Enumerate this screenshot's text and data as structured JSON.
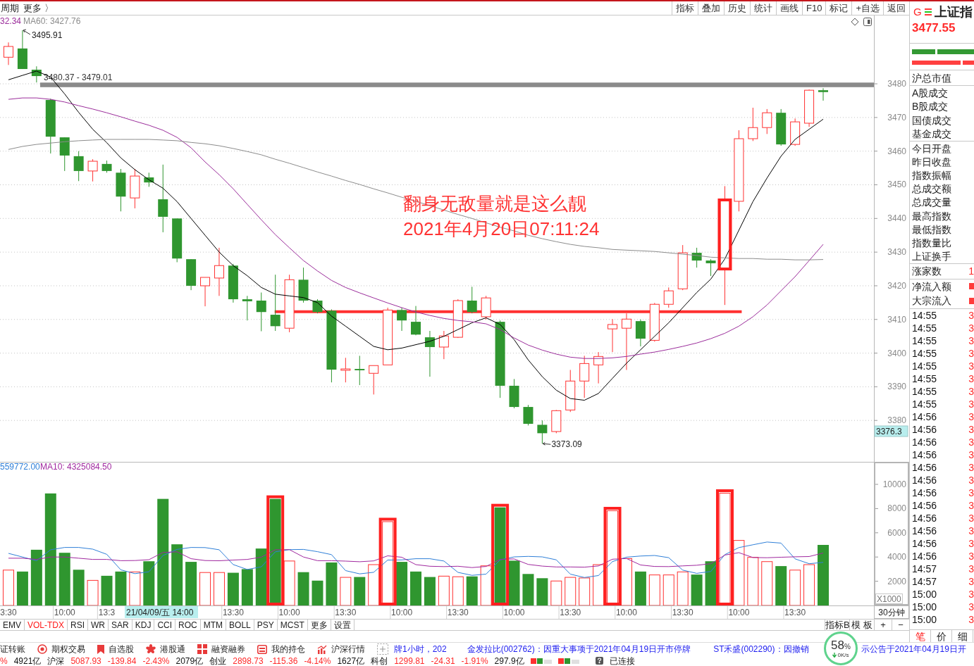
{
  "toolbar": {
    "menus": [
      "周期",
      "更多 〉"
    ],
    "buttons": [
      "指标",
      "叠加",
      "历史",
      "统计",
      "画线",
      "F10",
      "标记",
      "+自选",
      "返回"
    ]
  },
  "chart": {
    "price_legend": [
      {
        "text": "32.34",
        "color": "#9b2d9b"
      },
      {
        "text": "MA60: 3427.76",
        "color": "#8c8c8c"
      }
    ],
    "volume_legend": [
      {
        "text": "559772.00",
        "color": "#2f7fd8"
      },
      {
        "text": "MA10: 4325084.50",
        "color": "#a0289f"
      }
    ],
    "cursor_price": "3376.3",
    "cursor_time": "21/04/09/五 14:00",
    "period": "30分钟",
    "chart_data": [
      {
        "type": "candlestick",
        "ylim": [
          3367.7,
          3500.3
        ],
        "yticks": [
          3380,
          3390,
          3400,
          3410,
          3420,
          3430,
          3440,
          3450,
          3460,
          3470,
          3480
        ],
        "tick_labels": "y",
        "grid": true,
        "ohlc": [
          [
            3487.9,
            3492.3,
            3485.6,
            3491.1
          ],
          [
            3490.5,
            3495.91,
            3484.4,
            3484.4
          ],
          [
            3484.2,
            3485.2,
            3480.4,
            3482.3
          ],
          [
            3475.2,
            3475.6,
            3459.3,
            3464.3
          ],
          [
            3464.1,
            3464.1,
            3454.1,
            3458.7
          ],
          [
            3458.5,
            3460.0,
            3451.1,
            3454.1
          ],
          [
            3454.1,
            3457.6,
            3451.0,
            3457.0
          ],
          [
            3456.2,
            3457.2,
            3453.6,
            3454.1
          ],
          [
            3453.6,
            3454.7,
            3442.1,
            3446.5
          ],
          [
            3446.1,
            3454.7,
            3443.0,
            3452.6
          ],
          [
            3452.2,
            3453.6,
            3449.4,
            3450.7
          ],
          [
            3445.7,
            3456.0,
            3435.9,
            3440.5
          ],
          [
            3440.0,
            3440.0,
            3427.0,
            3428.1
          ],
          [
            3427.9,
            3427.9,
            3418.7,
            3420.0
          ],
          [
            3420.0,
            3422.5,
            3413.9,
            3422.5
          ],
          [
            3422.3,
            3431.3,
            3417.0,
            3426.0
          ],
          [
            3426.0,
            3426.5,
            3415.0,
            3416.0
          ],
          [
            3416.0,
            3417.0,
            3409.7,
            3415.4
          ],
          [
            3415.6,
            3418.0,
            3406.5,
            3412.2
          ],
          [
            3411.4,
            3423.3,
            3406.6,
            3408.0
          ],
          [
            3407.4,
            3423.3,
            3406.2,
            3421.8
          ],
          [
            3421.8,
            3425.4,
            3415.0,
            3415.6
          ],
          [
            3415.6,
            3416.0,
            3411.8,
            3412.2
          ],
          [
            3412.6,
            3413.0,
            3391.3,
            3395.1
          ],
          [
            3394.9,
            3398.6,
            3391.3,
            3395.3
          ],
          [
            3395.3,
            3399.2,
            3390.5,
            3394.9
          ],
          [
            3394.0,
            3396.3,
            3387.7,
            3396.3
          ],
          [
            3396.5,
            3413.5,
            3396.5,
            3412.8
          ],
          [
            3412.8,
            3413.5,
            3406.6,
            3409.7
          ],
          [
            3409.3,
            3414.0,
            3405.3,
            3405.5
          ],
          [
            3404.7,
            3406.6,
            3393.0,
            3401.8
          ],
          [
            3401.8,
            3406.6,
            3398.2,
            3405.1
          ],
          [
            3404.7,
            3416.0,
            3404.5,
            3415.6
          ],
          [
            3415.6,
            3419.7,
            3411.8,
            3412.2
          ],
          [
            3410.8,
            3417.0,
            3410.0,
            3416.4
          ],
          [
            3409.3,
            3409.7,
            3386.7,
            3390.3
          ],
          [
            3390.3,
            3392.3,
            3383.6,
            3384.0
          ],
          [
            3384.0,
            3384.6,
            3378.5,
            3379.0
          ],
          [
            3378.7,
            3380.0,
            3373.09,
            3376.2
          ],
          [
            3376.7,
            3383.1,
            3376.2,
            3382.9
          ],
          [
            3383.1,
            3395.0,
            3382.5,
            3391.7
          ],
          [
            3391.7,
            3399.2,
            3386.7,
            3396.9
          ],
          [
            3396.5,
            3400.3,
            3391.0,
            3399.0
          ],
          [
            3407.2,
            3410.1,
            3400.3,
            3408.5
          ],
          [
            3407.4,
            3411.8,
            3395.0,
            3410.1
          ],
          [
            3409.5,
            3410.0,
            3402.0,
            3404.3
          ],
          [
            3403.8,
            3414.9,
            3403.4,
            3414.5
          ],
          [
            3414.5,
            3419.5,
            3413.5,
            3418.5
          ],
          [
            3419.1,
            3432.1,
            3418.7,
            3429.8
          ],
          [
            3429.8,
            3431.3,
            3425.4,
            3427.5
          ],
          [
            3427.5,
            3427.9,
            3422.9,
            3426.7
          ],
          [
            3425.2,
            3449.6,
            3414.3,
            3445.3
          ],
          [
            3445.1,
            3466.2,
            3442.1,
            3463.7
          ],
          [
            3463.7,
            3472.9,
            3463.0,
            3467.0
          ],
          [
            3467.0,
            3472.5,
            3465.1,
            3471.4
          ],
          [
            3471.4,
            3472.5,
            3461.6,
            3462.0
          ],
          [
            3462.0,
            3469.7,
            3461.6,
            3468.7
          ],
          [
            3468.3,
            3478.3,
            3467.2,
            3478.1
          ],
          [
            3478.1,
            3478.7,
            3475.0,
            3477.55
          ]
        ],
        "series": [
          {
            "type": "line",
            "color": "#000000",
            "values": [
              3481.2,
              3482.5,
              3483.8,
              3482.0,
              3477.0,
              3471.5,
              3466.5,
              3462.5,
              3458.0,
              3454.5,
              3451.5,
              3449.0,
              3445.0,
              3440.0,
              3435.0,
              3430.0,
              3426.0,
              3423.0,
              3419.5,
              3417.5,
              3417.0,
              3416.5,
              3415.0,
              3411.0,
              3408.0,
              3405.0,
              3402.0,
              3401.0,
              3401.5,
              3402.5,
              3403.5,
              3405.0,
              3407.0,
              3409.0,
              3410.5,
              3408.5,
              3404.0,
              3398.0,
              3393.0,
              3389.0,
              3386.5,
              3386.0,
              3388.0,
              3392.5,
              3397.0,
              3401.0,
              3405.0,
              3409.0,
              3413.5,
              3418.0,
              3422.0,
              3428.0,
              3436.5,
              3445.0,
              3452.0,
              3458.5,
              3463.5,
              3466.5,
              3469.5
            ]
          },
          {
            "type": "line",
            "color": "#9b2d9b",
            "values": [
              3475.4,
              3475.8,
              3475.8,
              3475.4,
              3474.6,
              3473.5,
              3472.5,
              3471.4,
              3470.2,
              3468.9,
              3467.7,
              3466.2,
              3464.1,
              3461.0,
              3456.8,
              3453.0,
              3448.8,
              3444.2,
              3439.6,
              3435.2,
              3431.3,
              3427.5,
              3424.4,
              3421.6,
              3419.5,
              3417.9,
              3416.4,
              3414.9,
              3413.5,
              3412.2,
              3411.2,
              3410.3,
              3409.7,
              3409.3,
              3408.7,
              3407.0,
              3404.5,
              3402.4,
              3400.9,
              3399.7,
              3398.8,
              3398.4,
              3398.4,
              3398.6,
              3399.0,
              3399.7,
              3400.3,
              3401.1,
              3402.0,
              3403.0,
              3404.3,
              3405.9,
              3408.0,
              3410.8,
              3414.3,
              3418.5,
              3422.7,
              3427.5,
              3432.3
            ]
          },
          {
            "type": "line",
            "color": "#8c8c8c",
            "values": [
              3460.5,
              3461.4,
              3462.0,
              3462.4,
              3462.8,
              3463.1,
              3463.3,
              3463.5,
              3463.5,
              3463.5,
              3463.5,
              3463.3,
              3463.1,
              3462.6,
              3462.2,
              3461.6,
              3460.8,
              3459.9,
              3458.9,
              3457.6,
              3456.4,
              3455.1,
              3453.8,
              3452.6,
              3451.3,
              3450.1,
              3448.8,
              3447.6,
              3446.3,
              3445.1,
              3443.8,
              3442.5,
              3441.2,
              3440.0,
              3438.7,
              3437.4,
              3436.3,
              3435.0,
              3434.0,
              3433.1,
              3432.3,
              3431.7,
              3431.3,
              3430.8,
              3430.6,
              3430.4,
              3430.2,
              3429.8,
              3429.4,
              3429.0,
              3428.5,
              3428.3,
              3428.1,
              3428.1,
              3427.9,
              3427.9,
              3427.7,
              3427.7,
              3427.8
            ]
          }
        ],
        "bands": [
          {
            "axis": "y",
            "from": 3479.01,
            "to": 3480.37,
            "label": "3480.37 - 3479.01",
            "color": "#8a8a8a"
          }
        ],
        "ref_lines": [
          {
            "axis": "y",
            "value": 3412.3,
            "color": "#ff3030"
          }
        ],
        "annotations": [
          "3495.91",
          "3373.09",
          "翻身无敌量就是这么靓",
          "2021年4月20日07:11:24"
        ]
      },
      {
        "type": "bar",
        "ylabel": "X1000",
        "ylim": [
          0,
          11860
        ],
        "yticks": [
          2000,
          4000,
          6000,
          8000,
          10000
        ],
        "categories": [
          "3:30",
          null,
          null,
          null,
          "10:00",
          null,
          null,
          "13:3",
          null,
          null,
          null,
          null,
          null,
          null,
          null,
          null,
          "13:30",
          null,
          null,
          null,
          "10:00",
          null,
          null,
          null,
          "13:30",
          null,
          null,
          null,
          "10:00",
          null,
          null,
          null,
          "13:30",
          null,
          null,
          null,
          "10:00",
          null,
          null,
          null,
          "13:30",
          null,
          null,
          null,
          "10:00",
          null,
          null,
          null,
          "13:30",
          null,
          null,
          null,
          "10:00",
          null,
          null,
          null,
          "13:30",
          null,
          null
        ],
        "series": [
          {
            "type": "bar",
            "colors": [
              "#ff3232",
              "#2f962f",
              "#2f962f",
              "#2f962f",
              "#2f962f",
              "#2f962f",
              "#ff3232",
              "#2f962f",
              "#2f962f",
              "#ff3232",
              "#2f962f",
              "#2f962f",
              "#2f962f",
              "#2f962f",
              "#ff3232",
              "#ff3232",
              "#2f962f",
              "#2f962f",
              "#2f962f",
              "#2f962f",
              "#ff3232",
              "#2f962f",
              "#2f962f",
              "#2f962f",
              "#ff3232",
              "#2f962f",
              "#ff3232",
              "#ff3232",
              "#2f962f",
              "#2f962f",
              "#2f962f",
              "#ff3232",
              "#ff3232",
              "#2f962f",
              "#ff3232",
              "#2f962f",
              "#2f962f",
              "#2f962f",
              "#2f962f",
              "#ff3232",
              "#ff3232",
              "#ff3232",
              "#ff3232",
              "#ff3232",
              "#ff3232",
              "#2f962f",
              "#ff3232",
              "#ff3232",
              "#ff3232",
              "#2f962f",
              "#2f962f",
              "#ff3232",
              "#ff3232",
              "#ff3232",
              "#ff3232",
              "#2f962f",
              "#ff3232",
              "#ff3232",
              "#2f962f"
            ],
            "values": [
              2950,
              2800,
              4600,
              9250,
              4350,
              2950,
              2100,
              2450,
              2800,
              2800,
              3650,
              8800,
              5050,
              3600,
              2750,
              2750,
              2700,
              3000,
              4700,
              8800,
              3700,
              2750,
              2050,
              3550,
              2350,
              2350,
              3400,
              6950,
              3600,
              2800,
              2350,
              2450,
              2400,
              2400,
              3300,
              8100,
              3700,
              2600,
              2250,
              2050,
              2350,
              2300,
              3400,
              7850,
              3900,
              2800,
              2550,
              2550,
              2800,
              2550,
              3650,
              9300,
              5400,
              4000,
              3650,
              3250,
              2950,
              3400,
              5000
            ]
          },
          {
            "type": "line",
            "color": "#2f7fd8",
            "values": [
              4300,
              4000,
              3700,
              4600,
              4790,
              4790,
              4650,
              4220,
              2940,
              2630,
              2780,
              4120,
              4630,
              4790,
              4780,
              4600,
              3380,
              2970,
              3190,
              4430,
              4610,
              4630,
              4440,
              4200,
              2880,
              2610,
              2740,
              3750,
              3760,
              3860,
              3860,
              3670,
              2730,
              2490,
              2590,
              3760,
              4010,
              4050,
              4010,
              3770,
              2590,
              2310,
              2470,
              3620,
              3990,
              4080,
              4130,
              3950,
              2920,
              2650,
              2810,
              4200,
              4780,
              5010,
              5240,
              5150,
              3850,
              3450,
              3560
            ]
          },
          {
            "type": "line",
            "color": "#a0289f",
            "values": [
              3900,
              3900,
              3800,
              4000,
              4000,
              3900,
              3800,
              3800,
              3700,
              3710,
              3780,
              4380,
              4430,
              3860,
              3710,
              3690,
              3750,
              3800,
              3990,
              4600,
              4610,
              4000,
              3700,
              3700,
              3660,
              3610,
              3680,
              4100,
              3980,
              3370,
              3240,
              3210,
              3240,
              3130,
              3220,
              3810,
              3840,
              3390,
              3250,
              3180,
              3180,
              3160,
              3260,
              3820,
              3880,
              3340,
              3220,
              3210,
              3270,
              3320,
              3450,
              4160,
              4360,
              3960,
              3940,
              3980,
              4020,
              4040,
              4330
            ]
          }
        ]
      }
    ]
  },
  "indicator_tabs": [
    {
      "label": "EMV",
      "selected": false
    },
    {
      "label": "VOL-TDX",
      "selected": true
    },
    {
      "label": "RSI",
      "selected": false
    },
    {
      "label": "WR",
      "selected": false
    },
    {
      "label": "SAR",
      "selected": false
    },
    {
      "label": "KDJ",
      "selected": false
    },
    {
      "label": "CCI",
      "selected": false
    },
    {
      "label": "ROC",
      "selected": false
    },
    {
      "label": "MTM",
      "selected": false
    },
    {
      "label": "BOLL",
      "selected": false
    },
    {
      "label": "PSY",
      "selected": false
    },
    {
      "label": "MCST",
      "selected": false
    },
    {
      "label": "更多",
      "selected": false
    },
    {
      "label": "设置",
      "selected": false
    }
  ],
  "chart_controls": [
    "指标B",
    "模 板",
    "+",
    "−"
  ],
  "quote_panel": {
    "badge": "G",
    "title": "上证指",
    "price": "3477.55",
    "groups": [
      [
        {
          "kind": "plain",
          "label": "沪总市值"
        }
      ],
      [
        {
          "kind": "plain",
          "label": "A股成交"
        },
        {
          "kind": "plain",
          "label": "B股成交"
        },
        {
          "kind": "plain",
          "label": "国债成交"
        },
        {
          "kind": "plain",
          "label": "基金成交"
        }
      ],
      [
        {
          "kind": "plain",
          "label": "今日开盘"
        },
        {
          "kind": "plain",
          "label": "昨日收盘"
        },
        {
          "kind": "plain",
          "label": "指数振幅"
        },
        {
          "kind": "plain",
          "label": "总成交额"
        },
        {
          "kind": "plain",
          "label": "总成交量"
        },
        {
          "kind": "plain",
          "label": "最高指数"
        },
        {
          "kind": "plain",
          "label": "最低指数"
        },
        {
          "kind": "plain",
          "label": "指数量比"
        },
        {
          "kind": "plain",
          "label": "上证换手"
        }
      ],
      [
        {
          "kind": "value",
          "label": "涨家数",
          "value": "1"
        }
      ],
      [
        {
          "kind": "bar",
          "label": "净流入额"
        },
        {
          "kind": "bar",
          "label": "大宗流入"
        }
      ]
    ],
    "trades": [
      {
        "time": "14:55",
        "price": "3"
      },
      {
        "time": "14:55",
        "price": "3"
      },
      {
        "time": "14:55",
        "price": "3"
      },
      {
        "time": "14:55",
        "price": "3"
      },
      {
        "time": "14:55",
        "price": "3"
      },
      {
        "time": "14:55",
        "price": "3"
      },
      {
        "time": "14:55",
        "price": "3"
      },
      {
        "time": "14:55",
        "price": "3"
      },
      {
        "time": "14:56",
        "price": "3"
      },
      {
        "time": "14:56",
        "price": "3"
      },
      {
        "time": "14:56",
        "price": "3"
      },
      {
        "time": "14:56",
        "price": "3"
      },
      {
        "time": "14:56",
        "price": "3"
      },
      {
        "time": "14:56",
        "price": "3"
      },
      {
        "time": "14:56",
        "price": "3"
      },
      {
        "time": "14:56",
        "price": "3"
      },
      {
        "time": "14:56",
        "price": "3"
      },
      {
        "time": "14:56",
        "price": "3"
      },
      {
        "time": "14:56",
        "price": "3"
      },
      {
        "time": "14:56",
        "price": "3"
      },
      {
        "time": "14:57",
        "price": "3"
      },
      {
        "time": "14:57",
        "price": "3"
      },
      {
        "time": "15:00",
        "price": "3"
      },
      {
        "time": "15:00",
        "price": "3"
      },
      {
        "time": "15:00",
        "price": "3"
      }
    ],
    "tabs": [
      {
        "label": "笔",
        "selected": true
      },
      {
        "label": "价",
        "selected": false
      },
      {
        "label": "细",
        "selected": false
      }
    ]
  },
  "taskbar": {
    "items": [
      {
        "kind": "none",
        "label": "证转账"
      },
      {
        "kind": "target",
        "label": "期权交易"
      },
      {
        "kind": "bookmark",
        "label": "自选股"
      },
      {
        "kind": "flower",
        "label": "港股通"
      },
      {
        "kind": "grid",
        "label": "融资融券"
      },
      {
        "kind": "box",
        "label": "我的持仓"
      },
      {
        "kind": "chart",
        "label": "沪深行情"
      }
    ],
    "news": [
      "牌1小时，202",
      "金发拉比(002762)：因重大事项于2021年04月19日开市停牌",
      "ST禾盛(002290)：因撤销",
      "示公告于2021年04月19日开"
    ]
  },
  "speed_widget": {
    "percent": "58",
    "unit": "%",
    "rate": "0K/s"
  },
  "status_bar": {
    "items": [
      {
        "kind": "change",
        "text": "%"
      },
      {
        "kind": "plain",
        "text": "4921亿"
      },
      {
        "kind": "plain",
        "text": "沪深"
      },
      {
        "kind": "change",
        "text": "5087.93"
      },
      {
        "kind": "change",
        "text": "-139.84"
      },
      {
        "kind": "change",
        "text": "-2.43%"
      },
      {
        "kind": "plain",
        "text": "2079亿"
      },
      {
        "kind": "plain",
        "text": "创业"
      },
      {
        "kind": "change",
        "text": "2898.73"
      },
      {
        "kind": "change",
        "text": "-115.36"
      },
      {
        "kind": "change",
        "text": "-4.14%"
      },
      {
        "kind": "plain",
        "text": "1627亿"
      },
      {
        "kind": "plain",
        "text": "科创"
      },
      {
        "kind": "change",
        "text": "1299.81"
      },
      {
        "kind": "change",
        "text": "-24.31"
      },
      {
        "kind": "change",
        "text": "-1.91%"
      },
      {
        "kind": "plain",
        "text": "297.9亿"
      }
    ],
    "connection": "已连接"
  }
}
